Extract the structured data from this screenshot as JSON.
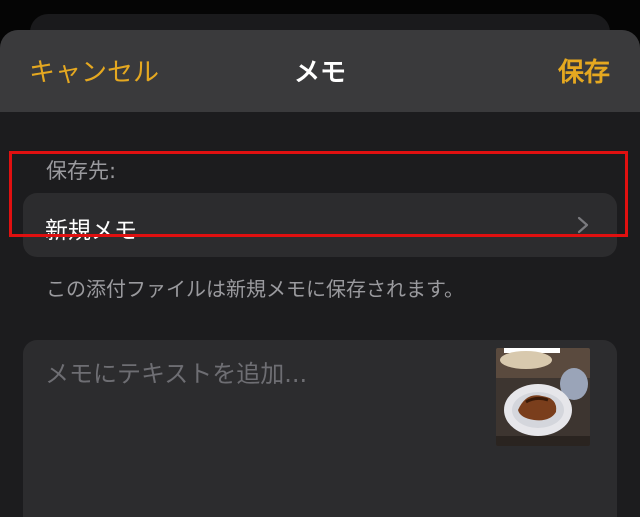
{
  "nav": {
    "cancel_label": "キャンセル",
    "title": "メモ",
    "save_label": "保存",
    "accent_color": "#e5a820"
  },
  "destination": {
    "section_label": "保存先:",
    "selected_label": "新規メモ",
    "chevron_icon": "chevron-right-icon",
    "info_text": "この添付ファイルは新規メモに保存されます。"
  },
  "note": {
    "placeholder": "メモにテキストを追加..."
  },
  "attachment": {
    "icon": "photo-thumbnail"
  }
}
